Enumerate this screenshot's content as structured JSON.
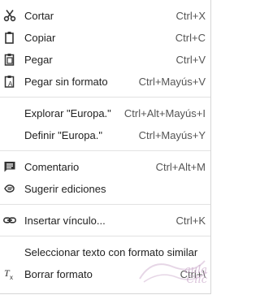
{
  "menu": {
    "items": [
      {
        "label": "Cortar",
        "shortcut": "Ctrl+X",
        "icon": "scissors-icon"
      },
      {
        "label": "Copiar",
        "shortcut": "Ctrl+C",
        "icon": "copy-icon"
      },
      {
        "label": "Pegar",
        "shortcut": "Ctrl+V",
        "icon": "paste-icon"
      },
      {
        "label": "Pegar sin formato",
        "shortcut": "Ctrl+Mayús+V",
        "icon": "paste-plain-icon"
      },
      {
        "label": "Explorar \"Europa.\"",
        "shortcut": "Ctrl+Alt+Mayús+I"
      },
      {
        "label": "Definir \"Europa.\"",
        "shortcut": "Ctrl+Mayús+Y"
      },
      {
        "label": "Comentario",
        "shortcut": "Ctrl+Alt+M",
        "icon": "comment-icon"
      },
      {
        "label": "Sugerir ediciones",
        "shortcut": "",
        "icon": "suggest-edits-icon"
      },
      {
        "label": "Insertar vínculo...",
        "shortcut": "Ctrl+K",
        "icon": "link-icon"
      },
      {
        "label": "Seleccionar texto con formato similar",
        "shortcut": ""
      },
      {
        "label": "Borrar formato",
        "shortcut": "Ctrl+\\",
        "icon": "clear-format-icon"
      }
    ]
  },
  "watermark": {
    "line1": "aula",
    "line2": "Clic"
  }
}
